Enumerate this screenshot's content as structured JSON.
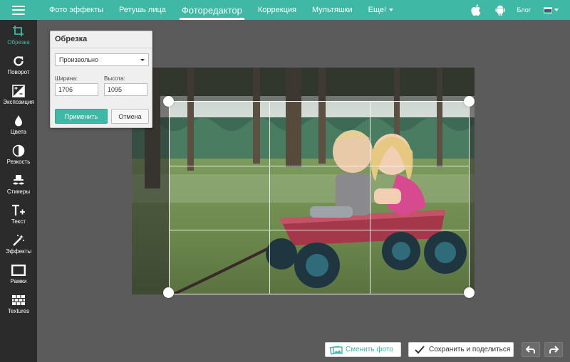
{
  "topbar": {
    "nav": [
      {
        "label": "Фото эффекты",
        "active": false
      },
      {
        "label": "Ретушь лица",
        "active": false
      },
      {
        "label": "Фоторедактор",
        "active": true
      },
      {
        "label": "Коррекция",
        "active": false
      },
      {
        "label": "Мультяшки",
        "active": false
      },
      {
        "label": "Еще!",
        "active": false,
        "has_dropdown": true
      }
    ],
    "blog_label": "Блог",
    "icons": [
      "apple-icon",
      "android-icon"
    ],
    "language": "ru",
    "accent_color": "#3fb8a6"
  },
  "sidebar": {
    "tools": [
      {
        "label": "Обрезка",
        "icon": "crop-icon",
        "active": true
      },
      {
        "label": "Поворот",
        "icon": "rotate-icon",
        "active": false
      },
      {
        "label": "Экспозиция",
        "icon": "exposure-icon",
        "active": false
      },
      {
        "label": "Цвета",
        "icon": "drop-icon",
        "active": false
      },
      {
        "label": "Резкость",
        "icon": "sharpness-icon",
        "active": false
      },
      {
        "label": "Стикеры",
        "icon": "hat-mustache-icon",
        "active": false
      },
      {
        "label": "Текст",
        "icon": "text-icon",
        "active": false
      },
      {
        "label": "Эффекты",
        "icon": "magic-wand-icon",
        "active": false
      },
      {
        "label": "Рамки",
        "icon": "frame-icon",
        "active": false
      },
      {
        "label": "Textures",
        "icon": "bricks-icon",
        "active": false
      }
    ]
  },
  "crop_panel": {
    "title": "Обрезка",
    "mode": "Произвольно",
    "width_label": "Ширина:",
    "height_label": "Высота:",
    "width_value": "1706",
    "height_value": "1095",
    "apply_label": "Применить",
    "cancel_label": "Отмена"
  },
  "bottom": {
    "change_photo_label": "Сменить фото",
    "save_share_label": "Сохранить и поделиться"
  }
}
